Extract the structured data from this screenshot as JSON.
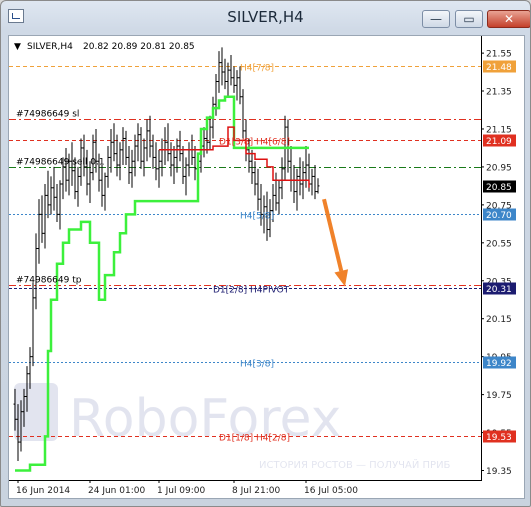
{
  "window": {
    "title": "SILVER,H4",
    "minimize_glyph": "—",
    "restore_glyph": "▭",
    "close_glyph": "✕",
    "app_icon": "chart-window-icon"
  },
  "chart_header": {
    "marker": "▼",
    "symbol": "SILVER,H4",
    "ohlc": "20.82 20.89 20.81 20.85"
  },
  "watermark": {
    "brand": "RoboForex",
    "tagline": "ИСТОРИЯ РОСТОВ — ПОЛУЧАЙ ПРИБ"
  },
  "colors": {
    "candles": "#000000",
    "green_line": "#3cf03c",
    "red_line": "#dd1111",
    "arrow": "#f0822a",
    "orange_level": "#f0a13a",
    "red_level": "#e03020",
    "blue_level": "#3d86c9",
    "navy_level": "#1c1c70"
  },
  "chart_data": {
    "type": "candlestick",
    "y_range": [
      19.3,
      21.64
    ],
    "y_ticks": [
      "21.55",
      "21.35",
      "21.15",
      "20.95",
      "20.75",
      "20.55",
      "20.35",
      "20.15",
      "19.95",
      "19.75",
      "19.55",
      "19.35"
    ],
    "x_ticks": [
      "16 Jun 2014",
      "24 Jun 01:00",
      "1 Jul 09:00",
      "8 Jul 21:00",
      "16 Jul 05:00"
    ],
    "x_tick_bars": [
      1,
      25,
      48,
      73,
      97
    ],
    "last_price": "20.85",
    "candles": [
      [
        19.7,
        19.78,
        19.56,
        19.62
      ],
      [
        19.62,
        19.7,
        19.4,
        19.5
      ],
      [
        19.5,
        19.72,
        19.45,
        19.66
      ],
      [
        19.66,
        19.78,
        19.58,
        19.74
      ],
      [
        19.74,
        19.9,
        19.66,
        19.86
      ],
      [
        19.86,
        20.0,
        19.78,
        19.95
      ],
      [
        19.95,
        20.34,
        19.9,
        20.26
      ],
      [
        20.26,
        20.6,
        20.2,
        20.52
      ],
      [
        20.52,
        20.78,
        20.44,
        20.7
      ],
      [
        20.7,
        20.8,
        20.55,
        20.6
      ],
      [
        20.6,
        20.86,
        20.52,
        20.8
      ],
      [
        20.8,
        20.93,
        20.68,
        20.75
      ],
      [
        20.75,
        20.9,
        20.7,
        20.84
      ],
      [
        20.84,
        20.95,
        20.72,
        20.79
      ],
      [
        20.79,
        20.86,
        20.66,
        20.7
      ],
      [
        20.7,
        20.88,
        20.62,
        20.86
      ],
      [
        20.86,
        21.0,
        20.78,
        20.95
      ],
      [
        20.95,
        21.05,
        20.82,
        20.88
      ],
      [
        20.88,
        21.02,
        20.8,
        20.98
      ],
      [
        20.98,
        21.08,
        20.85,
        20.93
      ],
      [
        20.93,
        21.0,
        20.78,
        20.82
      ],
      [
        20.82,
        20.95,
        20.74,
        20.9
      ],
      [
        20.9,
        21.1,
        20.85,
        21.05
      ],
      [
        21.05,
        21.12,
        20.9,
        20.95
      ],
      [
        20.95,
        21.04,
        20.8,
        20.86
      ],
      [
        20.86,
        20.98,
        20.76,
        20.92
      ],
      [
        20.92,
        21.12,
        20.88,
        21.08
      ],
      [
        21.08,
        21.15,
        20.92,
        20.98
      ],
      [
        20.98,
        21.02,
        20.82,
        20.88
      ],
      [
        20.88,
        20.96,
        20.74,
        20.8
      ],
      [
        20.8,
        20.92,
        20.72,
        20.9
      ],
      [
        20.9,
        21.06,
        20.84,
        21.0
      ],
      [
        21.0,
        21.15,
        20.92,
        21.08
      ],
      [
        21.08,
        21.18,
        20.98,
        21.02
      ],
      [
        21.02,
        21.12,
        20.9,
        20.96
      ],
      [
        20.96,
        21.08,
        20.88,
        21.04
      ],
      [
        21.04,
        21.16,
        20.96,
        21.1
      ],
      [
        21.1,
        21.14,
        20.96,
        21.0
      ],
      [
        21.0,
        21.06,
        20.86,
        20.92
      ],
      [
        20.92,
        21.04,
        20.84,
        20.98
      ],
      [
        20.98,
        21.12,
        20.9,
        21.06
      ],
      [
        21.06,
        21.18,
        20.98,
        21.12
      ],
      [
        21.12,
        21.16,
        20.94,
        20.98
      ],
      [
        20.98,
        21.1,
        20.9,
        21.05
      ],
      [
        21.05,
        21.2,
        20.98,
        21.14
      ],
      [
        21.14,
        21.22,
        21.0,
        21.06
      ],
      [
        21.06,
        21.12,
        20.94,
        21.0
      ],
      [
        21.0,
        21.08,
        20.88,
        20.94
      ],
      [
        20.94,
        21.04,
        20.84,
        20.98
      ],
      [
        20.98,
        21.1,
        20.9,
        21.04
      ],
      [
        21.04,
        21.16,
        20.96,
        21.08
      ],
      [
        21.08,
        21.18,
        20.98,
        21.02
      ],
      [
        21.02,
        21.08,
        20.9,
        20.96
      ],
      [
        20.96,
        21.06,
        20.86,
        21.0
      ],
      [
        21.0,
        21.1,
        20.92,
        21.06
      ],
      [
        21.06,
        21.14,
        20.98,
        21.02
      ],
      [
        21.02,
        21.06,
        20.86,
        20.9
      ],
      [
        20.9,
        21.0,
        20.8,
        20.96
      ],
      [
        20.96,
        21.08,
        20.9,
        21.04
      ],
      [
        21.04,
        21.12,
        20.96,
        21.0
      ],
      [
        21.0,
        21.06,
        20.88,
        20.94
      ],
      [
        20.94,
        21.02,
        20.84,
        20.98
      ],
      [
        20.98,
        21.1,
        20.92,
        21.06
      ],
      [
        21.06,
        21.16,
        21.0,
        21.1
      ],
      [
        21.1,
        21.18,
        21.02,
        21.08
      ],
      [
        21.08,
        21.22,
        21.04,
        21.16
      ],
      [
        21.16,
        21.32,
        21.1,
        21.28
      ],
      [
        21.28,
        21.44,
        21.22,
        21.4
      ],
      [
        21.4,
        21.56,
        21.34,
        21.5
      ],
      [
        21.5,
        21.58,
        21.38,
        21.45
      ],
      [
        21.45,
        21.52,
        21.36,
        21.4
      ],
      [
        21.4,
        21.5,
        21.32,
        21.46
      ],
      [
        21.46,
        21.54,
        21.38,
        21.42
      ],
      [
        21.42,
        21.48,
        21.34,
        21.38
      ],
      [
        21.38,
        21.46,
        21.3,
        21.42
      ],
      [
        21.42,
        21.48,
        21.28,
        21.32
      ],
      [
        21.32,
        21.36,
        21.1,
        21.14
      ],
      [
        21.14,
        21.2,
        20.98,
        21.04
      ],
      [
        21.04,
        21.1,
        20.92,
        20.98
      ],
      [
        20.98,
        21.04,
        20.86,
        20.92
      ],
      [
        20.92,
        20.98,
        20.8,
        20.86
      ],
      [
        20.86,
        20.94,
        20.72,
        20.78
      ],
      [
        20.78,
        20.86,
        20.64,
        20.7
      ],
      [
        20.7,
        20.8,
        20.6,
        20.74
      ],
      [
        20.74,
        20.82,
        20.56,
        20.62
      ],
      [
        20.62,
        20.78,
        20.58,
        20.72
      ],
      [
        20.72,
        20.86,
        20.66,
        20.8
      ],
      [
        20.8,
        20.92,
        20.72,
        20.76
      ],
      [
        20.76,
        20.88,
        20.7,
        20.84
      ],
      [
        20.84,
        21.0,
        20.78,
        20.94
      ],
      [
        20.94,
        21.22,
        20.88,
        21.16
      ],
      [
        21.16,
        21.2,
        20.92,
        20.98
      ],
      [
        20.98,
        21.06,
        20.82,
        20.88
      ],
      [
        20.88,
        20.96,
        20.76,
        20.82
      ],
      [
        20.82,
        20.94,
        20.72,
        20.9
      ],
      [
        20.9,
        21.0,
        20.8,
        20.86
      ],
      [
        20.86,
        20.98,
        20.78,
        20.92
      ],
      [
        20.92,
        21.06,
        20.84,
        20.96
      ],
      [
        20.96,
        21.02,
        20.82,
        20.86
      ],
      [
        20.86,
        20.94,
        20.8,
        20.9
      ],
      [
        20.9,
        20.96,
        20.78,
        20.82
      ],
      [
        20.82,
        20.89,
        20.81,
        20.85
      ]
    ],
    "green_trailing_stop": [
      [
        0,
        19.35
      ],
      [
        5,
        19.35
      ],
      [
        5,
        19.38
      ],
      [
        10,
        19.38
      ],
      [
        10,
        19.53
      ],
      [
        11,
        19.53
      ],
      [
        11,
        19.98
      ],
      [
        12,
        19.98
      ],
      [
        12,
        20.25
      ],
      [
        14,
        20.25
      ],
      [
        14,
        20.44
      ],
      [
        16,
        20.44
      ],
      [
        16,
        20.55
      ],
      [
        18,
        20.55
      ],
      [
        18,
        20.62
      ],
      [
        22,
        20.62
      ],
      [
        22,
        20.66
      ],
      [
        25,
        20.66
      ],
      [
        25,
        20.55
      ],
      [
        28,
        20.55
      ],
      [
        28,
        20.25
      ],
      [
        30,
        20.25
      ],
      [
        30,
        20.38
      ],
      [
        33,
        20.38
      ],
      [
        33,
        20.5
      ],
      [
        35,
        20.5
      ],
      [
        35,
        20.6
      ],
      [
        37,
        20.6
      ],
      [
        37,
        20.7
      ],
      [
        40,
        20.7
      ],
      [
        40,
        20.77
      ],
      [
        61,
        20.77
      ],
      [
        61,
        21.02
      ],
      [
        62,
        21.02
      ],
      [
        62,
        21.15
      ],
      [
        64,
        21.15
      ],
      [
        64,
        21.21
      ],
      [
        66,
        21.21
      ],
      [
        66,
        21.26
      ],
      [
        68,
        21.26
      ],
      [
        68,
        21.3
      ],
      [
        70,
        21.3
      ],
      [
        70,
        21.32
      ],
      [
        73,
        21.32
      ],
      [
        73,
        21.05
      ],
      [
        98,
        21.05
      ]
    ],
    "red_trailing_stop": [
      [
        48,
        21.04
      ],
      [
        66,
        21.04
      ],
      [
        66,
        21.06
      ],
      [
        71,
        21.06
      ],
      [
        71,
        21.16
      ],
      [
        73,
        21.16
      ],
      [
        73,
        21.09
      ],
      [
        77,
        21.09
      ],
      [
        77,
        21.02
      ],
      [
        80,
        21.02
      ],
      [
        80,
        20.99
      ],
      [
        84,
        20.99
      ],
      [
        84,
        20.95
      ],
      [
        86,
        20.95
      ],
      [
        86,
        20.88
      ],
      [
        98,
        20.88
      ],
      [
        98,
        20.84
      ]
    ],
    "levels": [
      {
        "name": "orange-level",
        "price": 21.48,
        "color": "#f0a13a",
        "dash": "4 3",
        "label": "H4[7/8]",
        "label_bar": 75,
        "badge": "21.48",
        "badge_bg": "#f0a13a",
        "badge_fg": "#ffffff"
      },
      {
        "name": "order-sl-level",
        "price": 21.2,
        "color": "#e03020",
        "dash": "7 3 2 3",
        "label": "#74986649 sl",
        "label_bar": -1,
        "badge": null
      },
      {
        "name": "red-level",
        "price": 21.09,
        "color": "#e03020",
        "dash": "4 3",
        "label": "D1[3/8] H4[6/8]",
        "label_bar": 68,
        "badge": "21.09",
        "badge_bg": "#e03020",
        "badge_fg": "#ffffff"
      },
      {
        "name": "order-entry-level",
        "price": 20.95,
        "color": "#1a7a1a",
        "dash": "7 3 2 3",
        "label": "#74986649 sell 0.1",
        "label_bar": -1,
        "badge": null
      },
      {
        "name": "blue-level",
        "price": 20.7,
        "color": "#3d86c9",
        "dash": "2 2",
        "label": "H4[5/8]",
        "label_bar": 75,
        "badge": "20.70",
        "badge_bg": "#3d86c9",
        "badge_fg": "#ffffff"
      },
      {
        "name": "order-tp-level",
        "price": 20.33,
        "color": "#e03020",
        "dash": "7 3 2 3",
        "label": "#74986649 tp",
        "label_bar": -1,
        "badge": null
      },
      {
        "name": "navy-level",
        "price": 20.31,
        "color": "#1c1c70",
        "dash": "3 2",
        "label": "D1[2/8] H4PIVOT",
        "label_bar": 66,
        "badge": "20.31",
        "badge_bg": "#1c1c70",
        "badge_fg": "#ffffff"
      },
      {
        "name": "lightblue-level",
        "price": 19.92,
        "color": "#3d86c9",
        "dash": "2 2",
        "label": "H4[3/8]",
        "label_bar": 75,
        "badge": "19.92",
        "badge_bg": "#3d86c9",
        "badge_fg": "#ffffff"
      },
      {
        "name": "bottom-red-level",
        "price": 19.53,
        "color": "#e03020",
        "dash": "4 3",
        "label": "D1[1/8] H4[2/8]",
        "label_bar": 68,
        "badge": "19.53",
        "badge_bg": "#e03020",
        "badge_fg": "#ffffff"
      }
    ],
    "arrow": {
      "from": [
        103,
        20.78
      ],
      "to": [
        110,
        20.32
      ]
    }
  }
}
